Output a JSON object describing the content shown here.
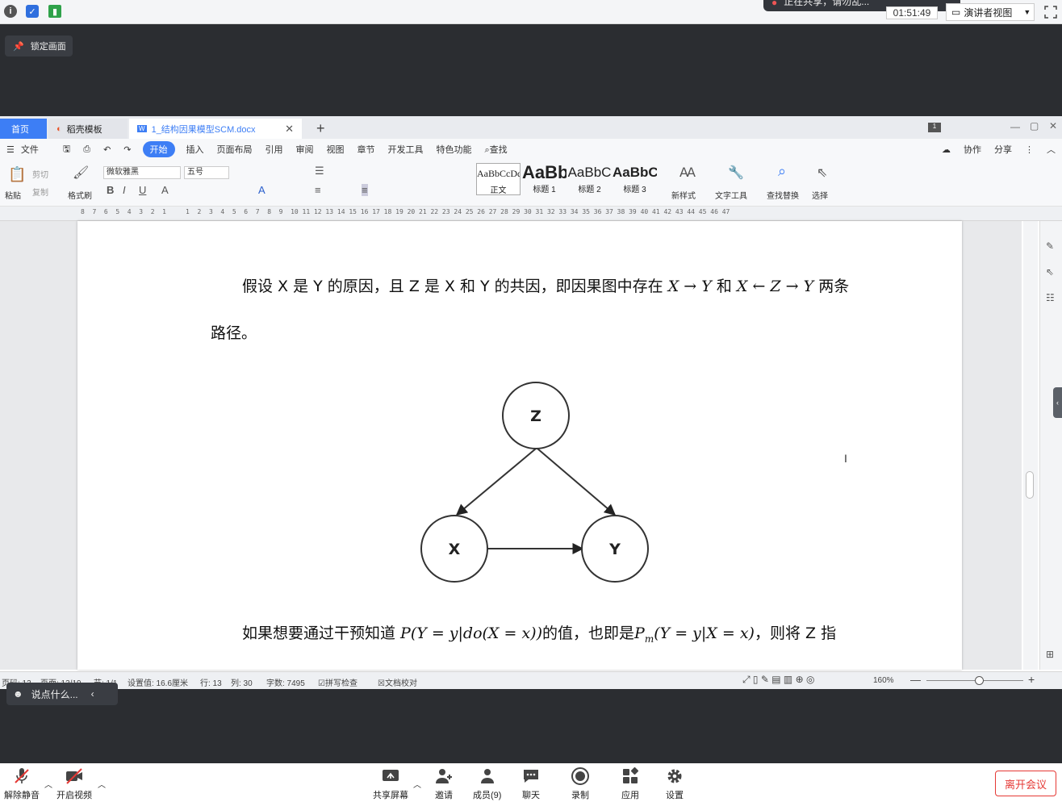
{
  "top": {
    "recording_text": "正在共享，请勿乱...",
    "timer": "01:51:49",
    "presenter_view": "演讲者视图"
  },
  "lock": {
    "label": "锁定画面"
  },
  "wps": {
    "tabs": {
      "home": "首页",
      "daoke": "稻壳模板",
      "doc": "1_结构因果模型SCM.docx"
    },
    "menu": [
      "文件",
      "开始",
      "插入",
      "页面布局",
      "引用",
      "审阅",
      "视图",
      "章节",
      "开发工具",
      "特色功能",
      "查找"
    ],
    "menu_right": {
      "cowork": "协作",
      "share": "分享"
    },
    "ribbon": {
      "paste": "粘贴",
      "cut": "剪切",
      "copy": "复制",
      "format_painter": "格式刷",
      "font": "微软雅黑",
      "size": "五号",
      "styles": [
        {
          "preview": "AaBbCcDd",
          "name": "正文"
        },
        {
          "preview": "AaBb",
          "name": "标题 1"
        },
        {
          "preview": "AaBbC",
          "name": "标题 2"
        },
        {
          "preview": "AaBbC",
          "name": "标题 3"
        }
      ],
      "new_style": "新样式",
      "text_tools": "文字工具",
      "find_replace": "查找替换",
      "select": "选择"
    },
    "ruler": "8  7  6  5  4  3  2  1     1  2  3  4  5  6  7  8  9  10 11 12 13 14 15 16 17 18 19 20 21 22 23 24 25 26 27 28 29 30 31 32 33 34 35 36 37 38 39 40 41 42 43 44 45 46 47",
    "doc": {
      "p1_prefix": "假设 X 是 Y 的原因，且 Z 是 X 和 Y 的共因，即因果图中存在 ",
      "p1_math1": "X → Y",
      "p1_mid": " 和 ",
      "p1_math2": "X ← Z → Y",
      "p1_suffix": " 两条",
      "p1_line2": "路径。",
      "graph_nodes": {
        "z": "Z",
        "x": "X",
        "y": "Y"
      },
      "p2_prefix": "如果想要通过干预知道 ",
      "p2_math1": "P(Y = y|do(X = x))",
      "p2_mid": "的值，也即是",
      "p2_math2": "P",
      "p2_math2_sub": "m",
      "p2_math3": "(Y = y|X = x)",
      "p2_suffix": "，则将 Z 指"
    },
    "status": {
      "page": "页码: 13",
      "pages": "页面: 13/19",
      "section": "节: 1/1",
      "setting": "设置值: 16.6厘米",
      "row": "行: 13",
      "col": "列: 30",
      "words": "字数: 7495",
      "spell": "拼写检查",
      "proof": "文档校对",
      "zoom": "160%"
    }
  },
  "chat": {
    "placeholder": "说点什么..."
  },
  "bottom": {
    "unmute": "解除静音",
    "video": "开启视频",
    "share": "共享屏幕",
    "invite": "邀请",
    "members": "成员(9)",
    "chat": "聊天",
    "record": "录制",
    "apps": "应用",
    "settings": "设置",
    "leave": "离开会议"
  },
  "colors": {
    "accent": "#3d7ef5",
    "leave": "#e53935"
  }
}
